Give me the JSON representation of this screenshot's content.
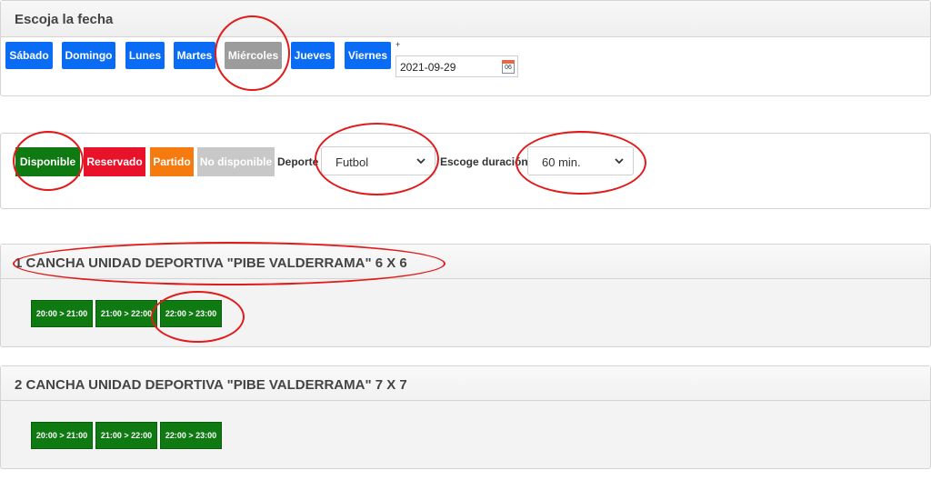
{
  "date_panel": {
    "title": "Escoja la fecha",
    "days": [
      "Sábado",
      "Domingo",
      "Lunes",
      "Martes",
      "Miércoles",
      "Jueves",
      "Viernes"
    ],
    "selected_day": "Miércoles",
    "plus_mark": "+",
    "date_value": "2021-09-29",
    "calendar_icon_text": "06"
  },
  "legend": {
    "available": "Disponible",
    "reserved": "Reservado",
    "match": "Partido",
    "unavailable": "No disponible",
    "sport_label": "Deporte",
    "sport_value": "Futbol",
    "duration_label": "Escoge duración",
    "duration_value": "60 min."
  },
  "courts": [
    {
      "title": "1 CANCHA UNIDAD DEPORTIVA \"PIBE VALDERRAMA\" 6 X 6",
      "slots": [
        "20:00 > 21:00",
        "21:00 > 22:00",
        "22:00 > 23:00"
      ]
    },
    {
      "title": "2 CANCHA UNIDAD DEPORTIVA \"PIBE VALDERRAMA\" 7 X 7",
      "slots": [
        "20:00 > 21:00",
        "21:00 > 22:00",
        "22:00 > 23:00"
      ]
    }
  ],
  "colors": {
    "day_button": "#0a6cf5",
    "day_selected": "#9c9c9c",
    "available": "#0f7a12",
    "reserved": "#e8122a",
    "match": "#f57a0f",
    "unavailable": "#c8c8c8",
    "annotation": "#e21a1a"
  },
  "icons": [
    "calendar-icon",
    "chevron-down-icon"
  ]
}
